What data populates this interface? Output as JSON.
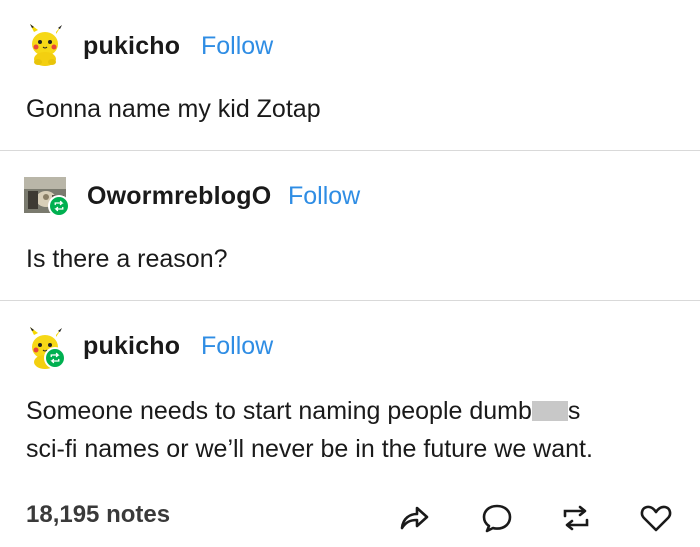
{
  "posts": [
    {
      "username": "pukicho",
      "follow_label": "Follow",
      "body": "Gonna name my kid Zotap",
      "avatar_icon": "pikachu-plush-icon"
    },
    {
      "username": "OwormreblogO",
      "follow_label": "Follow",
      "body": "Is there a reason?",
      "avatar_icon": "photo-avatar-icon",
      "reblog_badge": true
    },
    {
      "username": "pukicho",
      "follow_label": "Follow",
      "body_line1_before": "Someone needs to start naming people dumb",
      "body_line1_after": "s",
      "body_line2": "sci-fi names or we’ll never be in the future we want.",
      "avatar_icon": "pikachu-plush-icon",
      "reblog_badge": true
    }
  ],
  "footer": {
    "notes": "18,195 notes",
    "actions": [
      "share-icon",
      "comment-icon",
      "reblog-icon",
      "like-icon"
    ]
  },
  "colors": {
    "follow": "#2f8de4",
    "reblog_badge": "#00b050",
    "divider": "#d9d9d9",
    "text": "#1a1a1a"
  }
}
